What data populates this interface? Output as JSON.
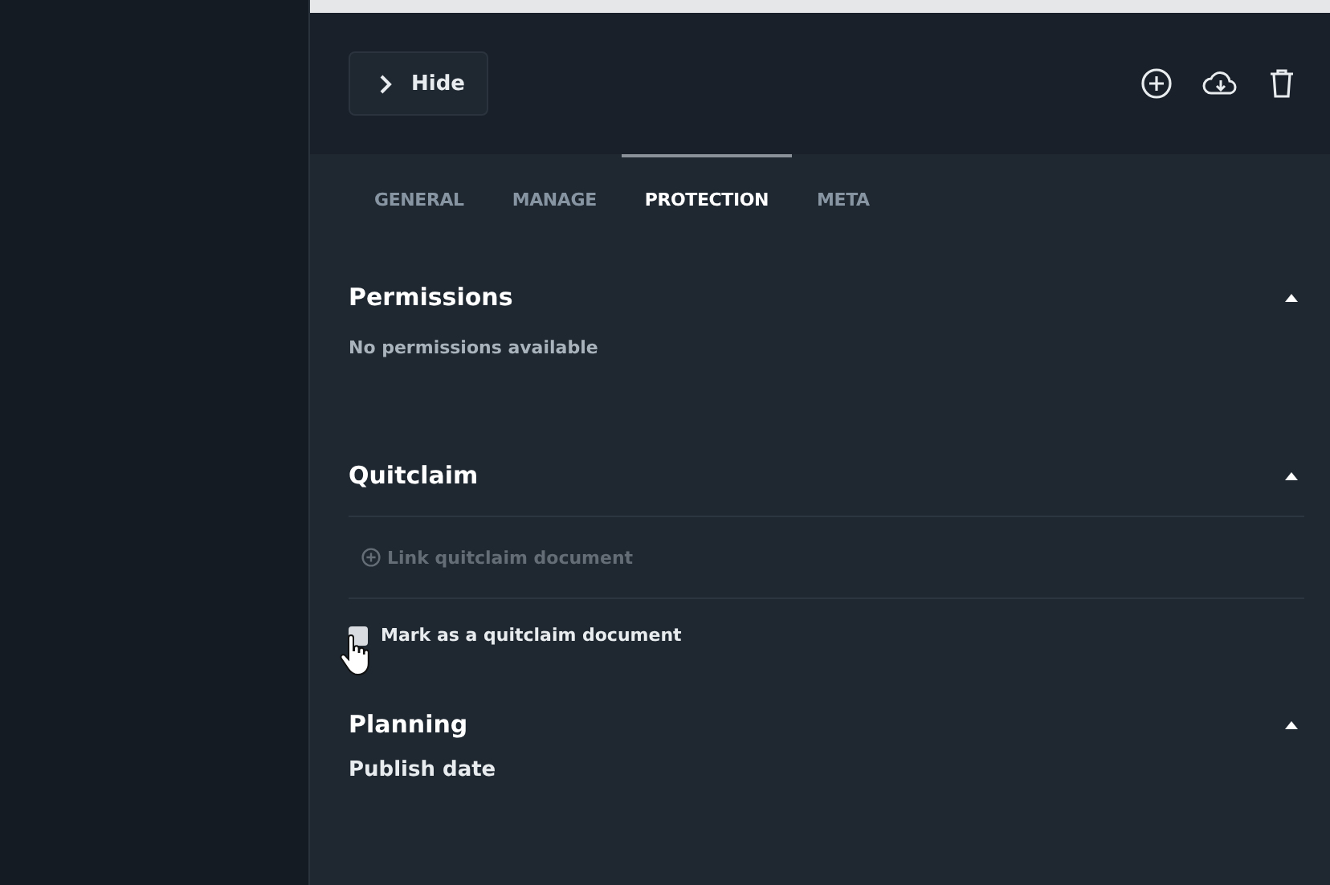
{
  "header": {
    "hide_button": {
      "label": "Hide"
    }
  },
  "tabs": [
    {
      "label": "GENERAL",
      "selected": false
    },
    {
      "label": "MANAGE",
      "selected": false
    },
    {
      "label": "PROTECTION",
      "selected": true
    },
    {
      "label": "META",
      "selected": false
    }
  ],
  "sections": [
    {
      "kind": "permissions",
      "title": "Permissions",
      "expanded": true,
      "message": "No permissions available"
    },
    {
      "kind": "quitclaim",
      "title": "Quitclaim",
      "expanded": true,
      "link": {
        "label": "Link quitclaim document",
        "disabled": true
      },
      "checkbox": {
        "label": "Mark as a quitclaim document",
        "checked": false
      }
    },
    {
      "kind": "planning",
      "title": "Planning",
      "expanded": true,
      "field_label": "Publish date"
    }
  ]
}
